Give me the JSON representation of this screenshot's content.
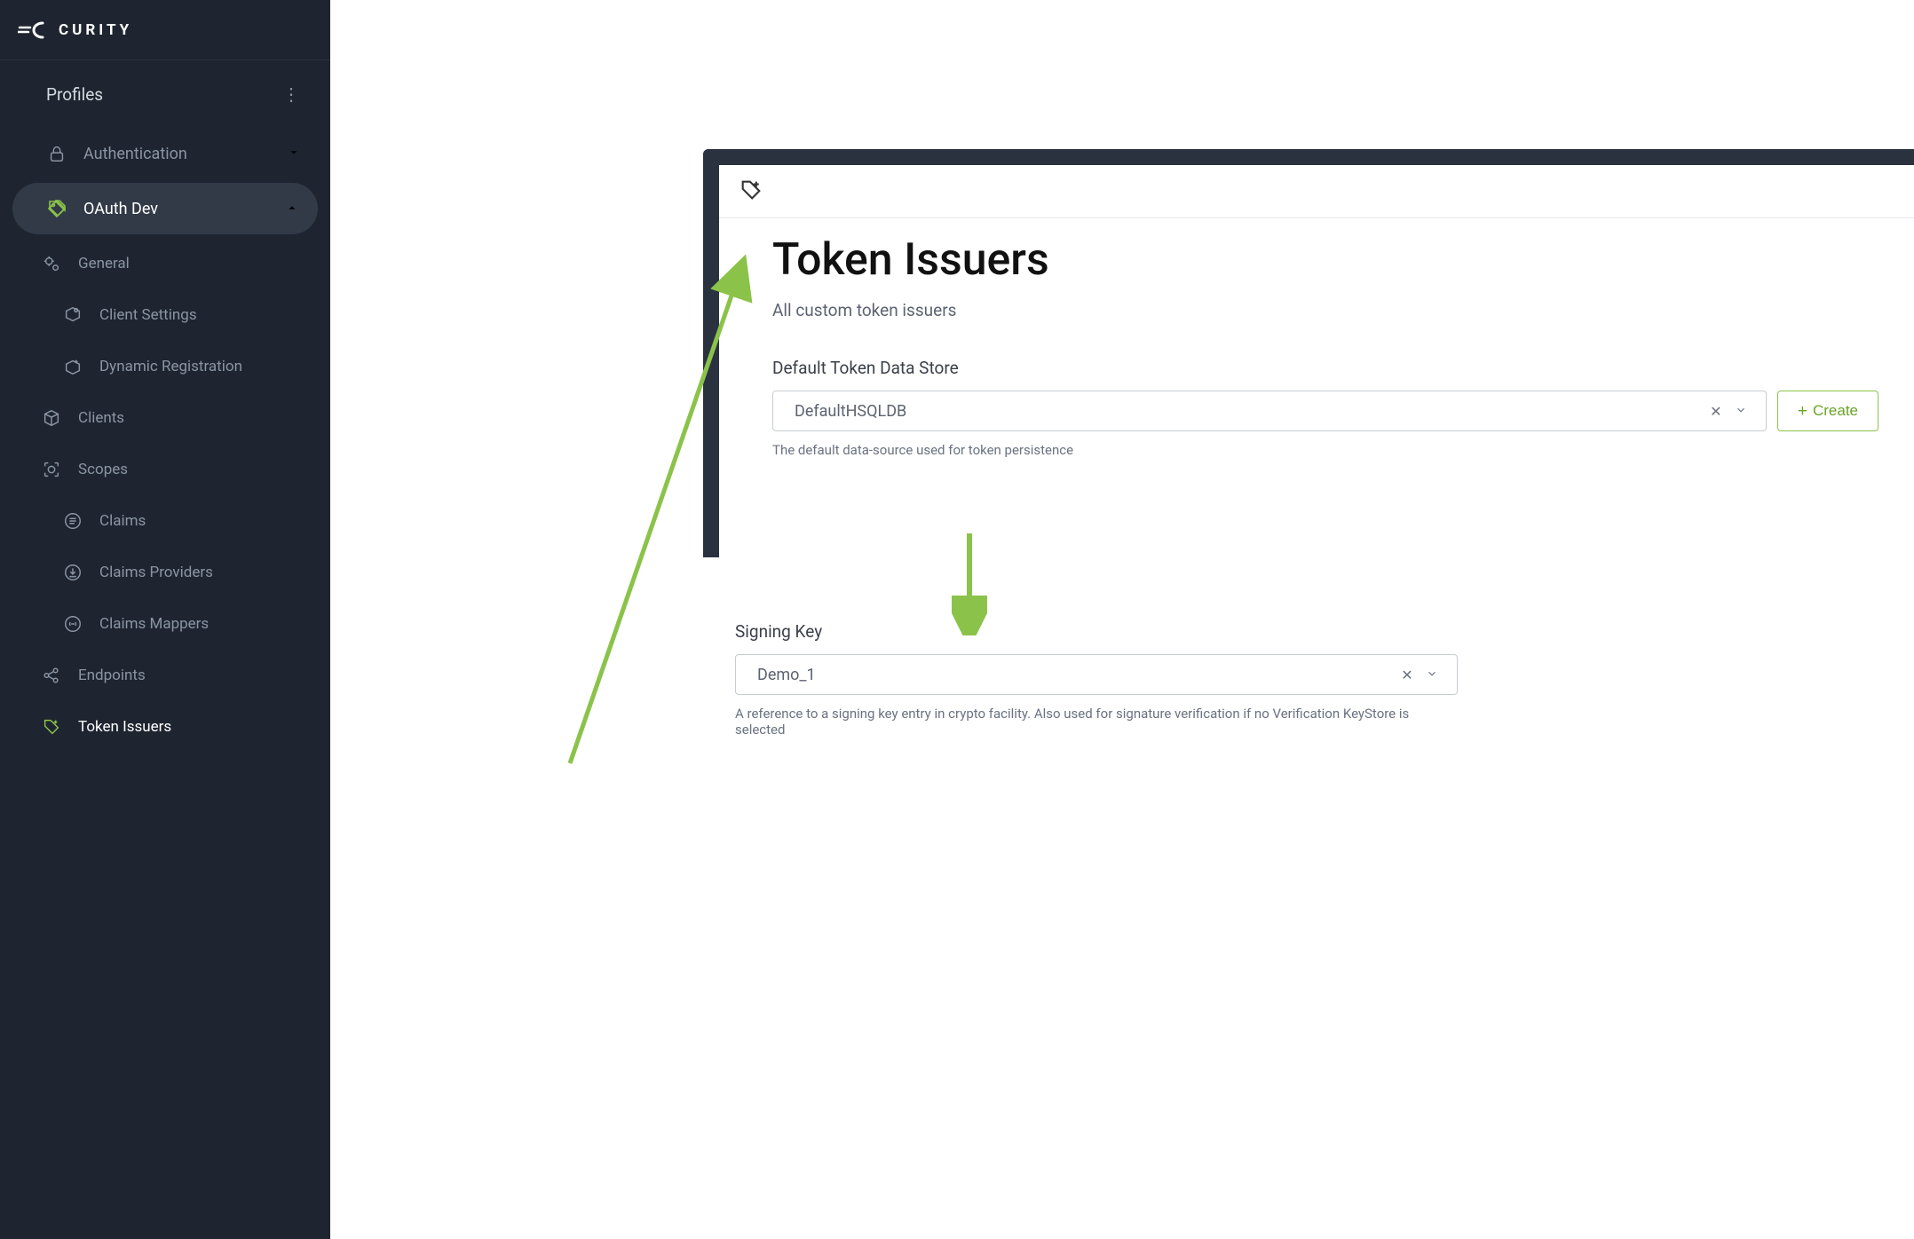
{
  "brand": {
    "name": "CURITY"
  },
  "sidebar": {
    "header": "Profiles",
    "items": [
      {
        "label": "Authentication",
        "icon": "lock-icon",
        "expandable": true,
        "expanded": false
      },
      {
        "label": "OAuth Dev",
        "icon": "tag-icon",
        "expandable": true,
        "expanded": true,
        "active": true,
        "children": [
          {
            "label": "General",
            "icon": "gears-icon"
          },
          {
            "label": "Client Settings",
            "icon": "box-gear-icon",
            "indent": true
          },
          {
            "label": "Dynamic Registration",
            "icon": "box-plus-icon",
            "indent": true
          },
          {
            "label": "Clients",
            "icon": "cube-icon"
          },
          {
            "label": "Scopes",
            "icon": "target-icon"
          },
          {
            "label": "Claims",
            "icon": "list-circle-icon",
            "indent": true
          },
          {
            "label": "Claims Providers",
            "icon": "download-circle-icon",
            "indent": true
          },
          {
            "label": "Claims Mappers",
            "icon": "link-circle-icon",
            "indent": true
          },
          {
            "label": "Endpoints",
            "icon": "share-icon"
          },
          {
            "label": "Token Issuers",
            "icon": "tag-plus-icon",
            "selected": true
          }
        ]
      }
    ]
  },
  "page": {
    "title": "Token Issuers",
    "subtitle": "All custom token issuers",
    "dataStore": {
      "label": "Default Token Data Store",
      "value": "DefaultHSQLDB",
      "help": "The default data-source used for token persistence",
      "createLabel": "Create"
    },
    "signingKey": {
      "label": "Signing Key",
      "value": "Demo_1",
      "help": "A reference to a signing key entry in crypto facility. Also used for signature verification if no Verification KeyStore is selected"
    }
  }
}
